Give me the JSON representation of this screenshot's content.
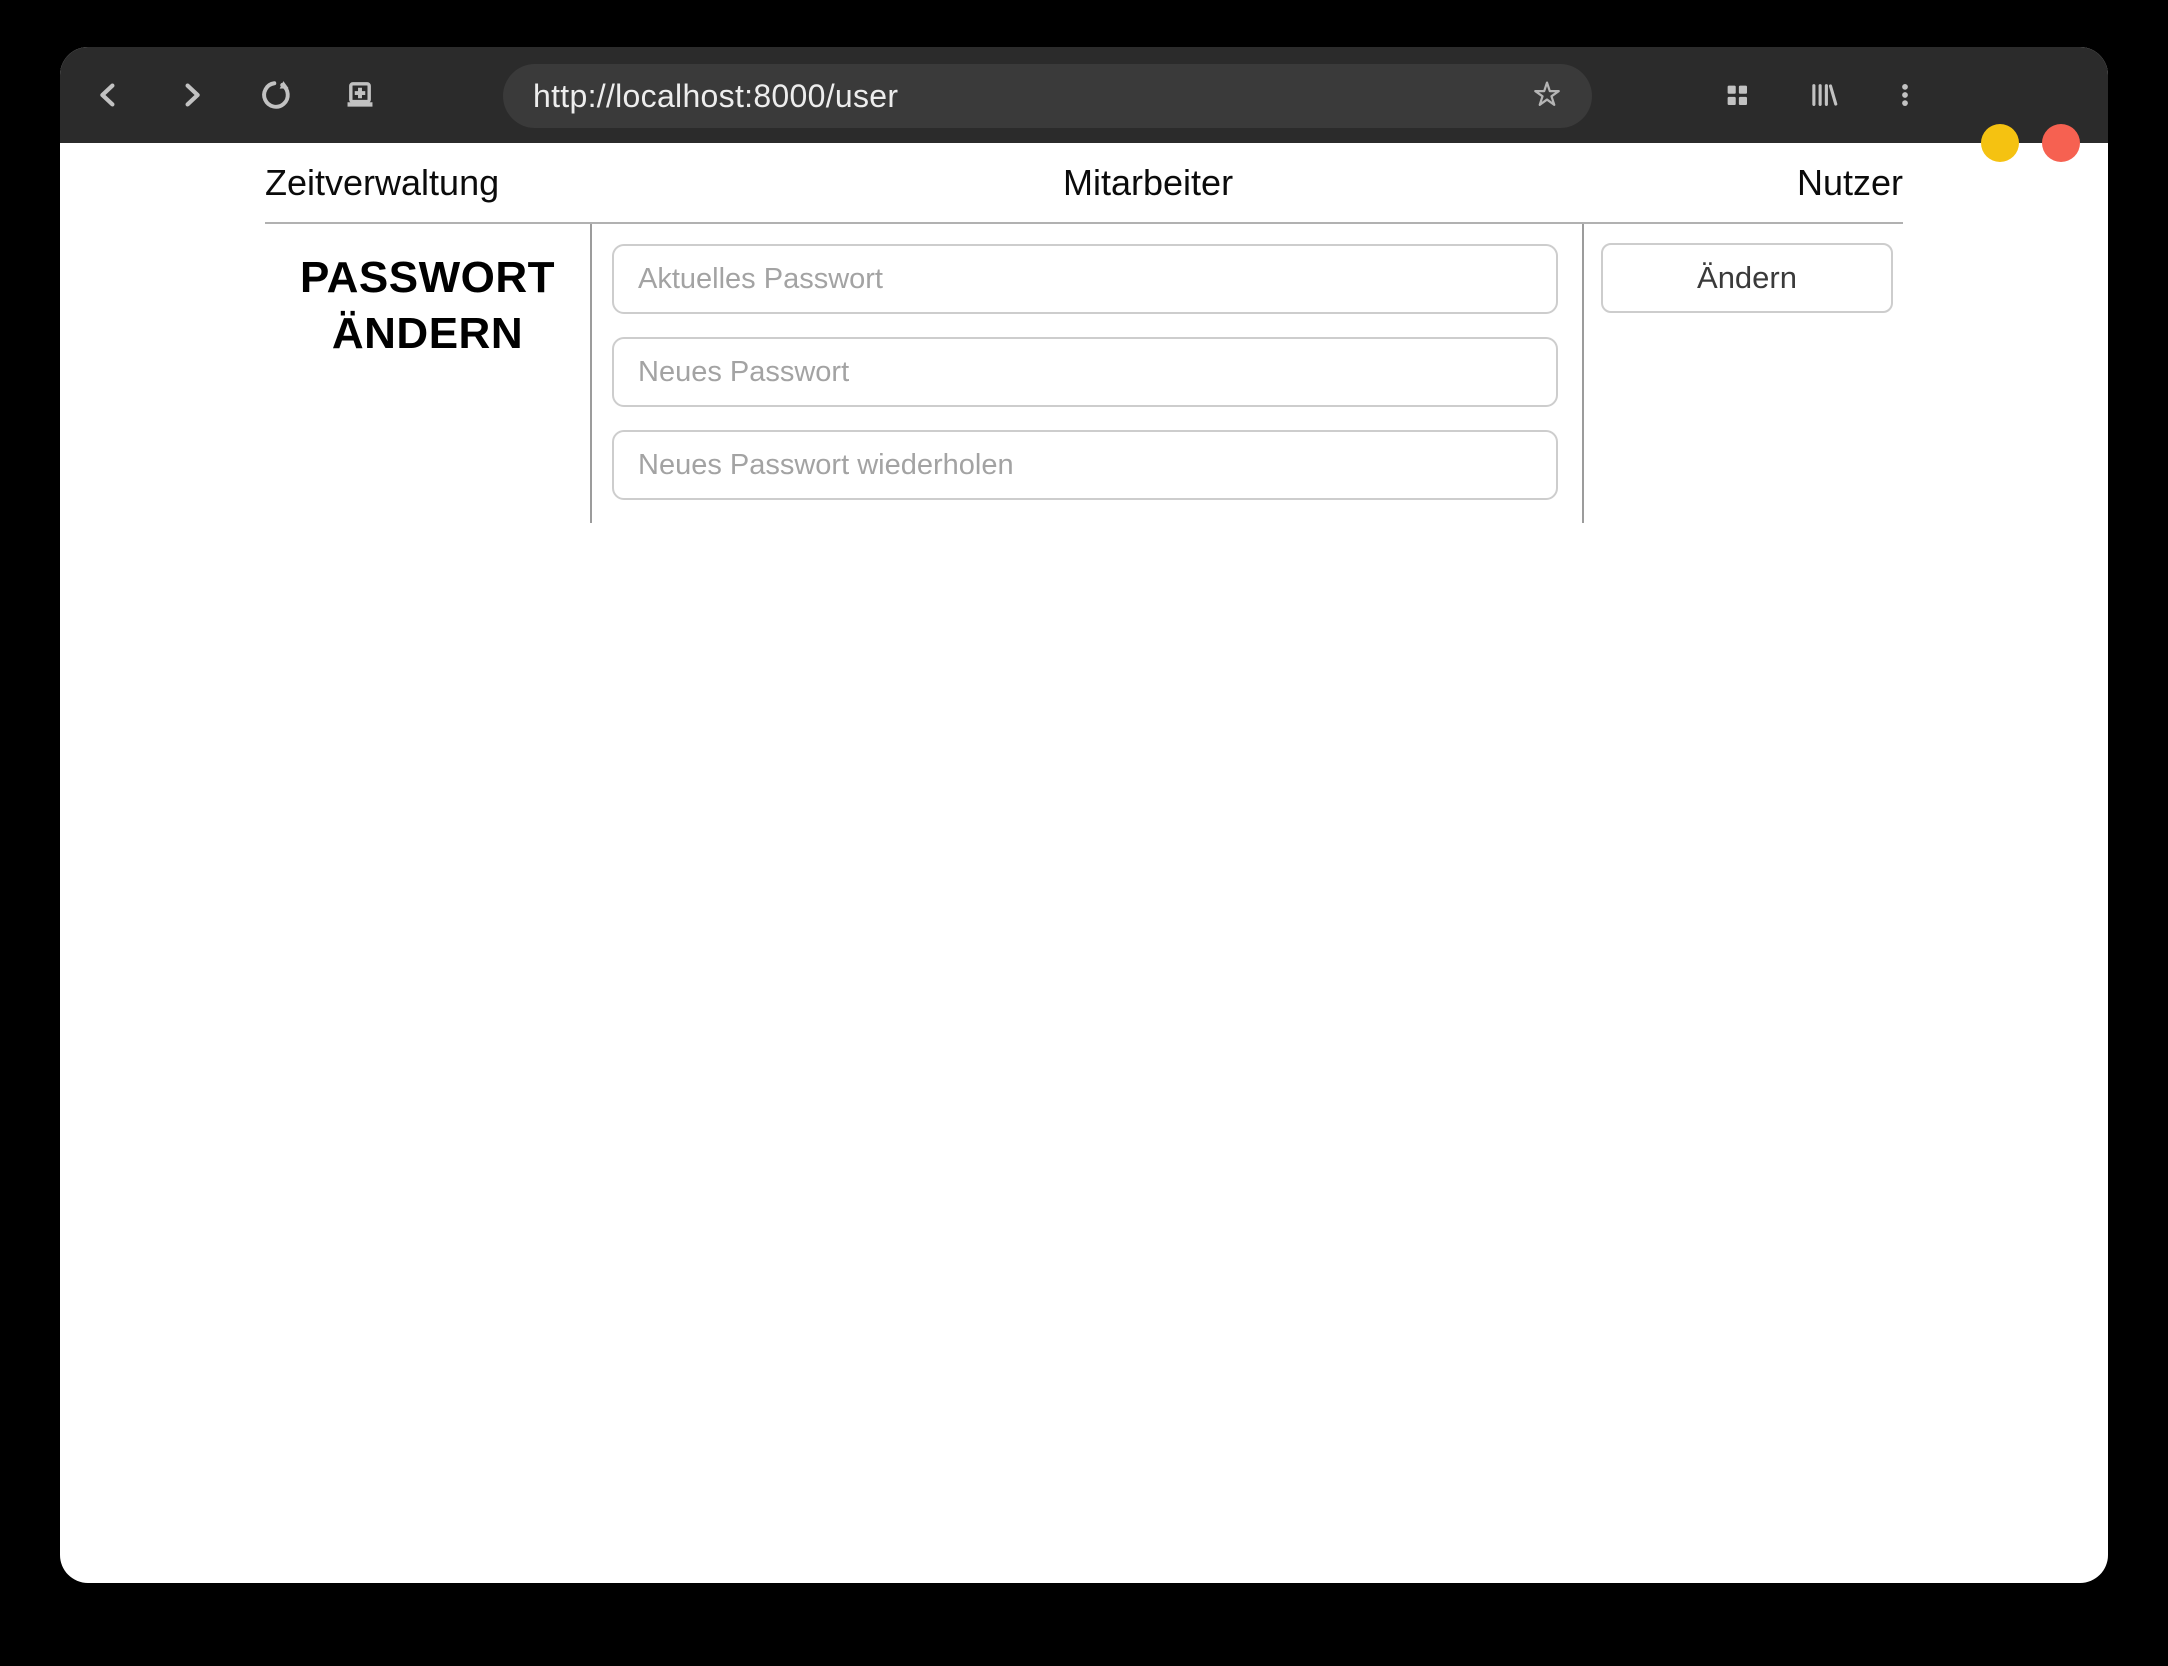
{
  "browser": {
    "url": "http://localhost:8000/user",
    "toolbar_icons": [
      "back-icon",
      "forward-icon",
      "reload-icon",
      "new-tab-icon",
      "bookmark-star-icon",
      "tab-grid-icon",
      "library-icon",
      "kebab-menu-icon"
    ],
    "colors": {
      "toolbar_bg": "#2b2b2b",
      "urlbar_bg": "#3a3a3a",
      "icon_gray": "#c2c2c2",
      "minimize_button": "#f5c211",
      "close_button": "#f66151"
    }
  },
  "nav": {
    "items": [
      {
        "label": "Zeitverwaltung"
      },
      {
        "label": "Mitarbeiter"
      },
      {
        "label": "Nutzer"
      }
    ]
  },
  "password_section": {
    "heading_line1": "PASSWORT",
    "heading_line2": "ÄNDERN",
    "fields": [
      {
        "placeholder": "Aktuelles Passwort",
        "value": ""
      },
      {
        "placeholder": "Neues Passwort",
        "value": ""
      },
      {
        "placeholder": "Neues Passwort wiederholen",
        "value": ""
      }
    ],
    "submit_label": "Ändern"
  }
}
